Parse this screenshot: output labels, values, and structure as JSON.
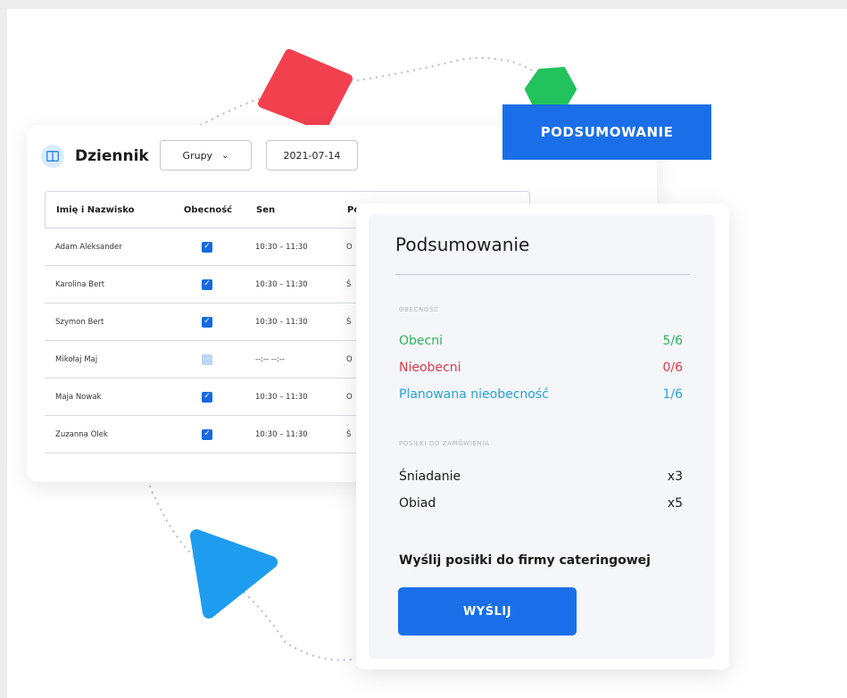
{
  "colors": {
    "accent": "#1a6fe8",
    "present": "#2db35b",
    "absent": "#e2394a",
    "planned": "#27a3d8",
    "shape_red": "#f2404f",
    "shape_green": "#22c25c",
    "shape_blue": "#1e9cf0"
  },
  "journal": {
    "title": "Dziennik",
    "icon": "book-icon",
    "group_select": "Grupy",
    "date": "2021-07-14",
    "columns": [
      "Imię i Nazwisko",
      "Obecność",
      "Sen",
      "Po"
    ],
    "rows": [
      {
        "name": "Adam Aleksander",
        "present": true,
        "sleep": "10:30 – 11:30",
        "extra": "O"
      },
      {
        "name": "Karolina Bert",
        "present": true,
        "sleep": "10:30 – 11:30",
        "extra": "Ś"
      },
      {
        "name": "Szymon Bert",
        "present": true,
        "sleep": "10:30 – 11:30",
        "extra": "Ś"
      },
      {
        "name": "Mikołaj Maj",
        "present": false,
        "sleep": "--:--  --:--",
        "extra": "O"
      },
      {
        "name": "Maja Nowak",
        "present": true,
        "sleep": "10:30 – 11:30",
        "extra": "O"
      },
      {
        "name": "Zuzanna Olek",
        "present": true,
        "sleep": "10:30 – 11:30",
        "extra": "Ś"
      }
    ]
  },
  "summary_button": "PODSUMOWANIE",
  "summary": {
    "title": "Podsumowanie",
    "attendance_header": "OBECNOŚĆ",
    "attendance": [
      {
        "label": "Obecni",
        "value": "5/6"
      },
      {
        "label": "Nieobecni",
        "value": "0/6"
      },
      {
        "label": "Planowana nieobecność",
        "value": "1/6"
      }
    ],
    "meals_header": "POSIŁKI DO ZAMÓWIENIA",
    "meals": [
      {
        "label": "Śniadanie",
        "value": "x3"
      },
      {
        "label": "Obiad",
        "value": "x5"
      }
    ],
    "send_label": "Wyślij posiłki do firmy cateringowej",
    "send_button": "WYŚLIJ"
  }
}
